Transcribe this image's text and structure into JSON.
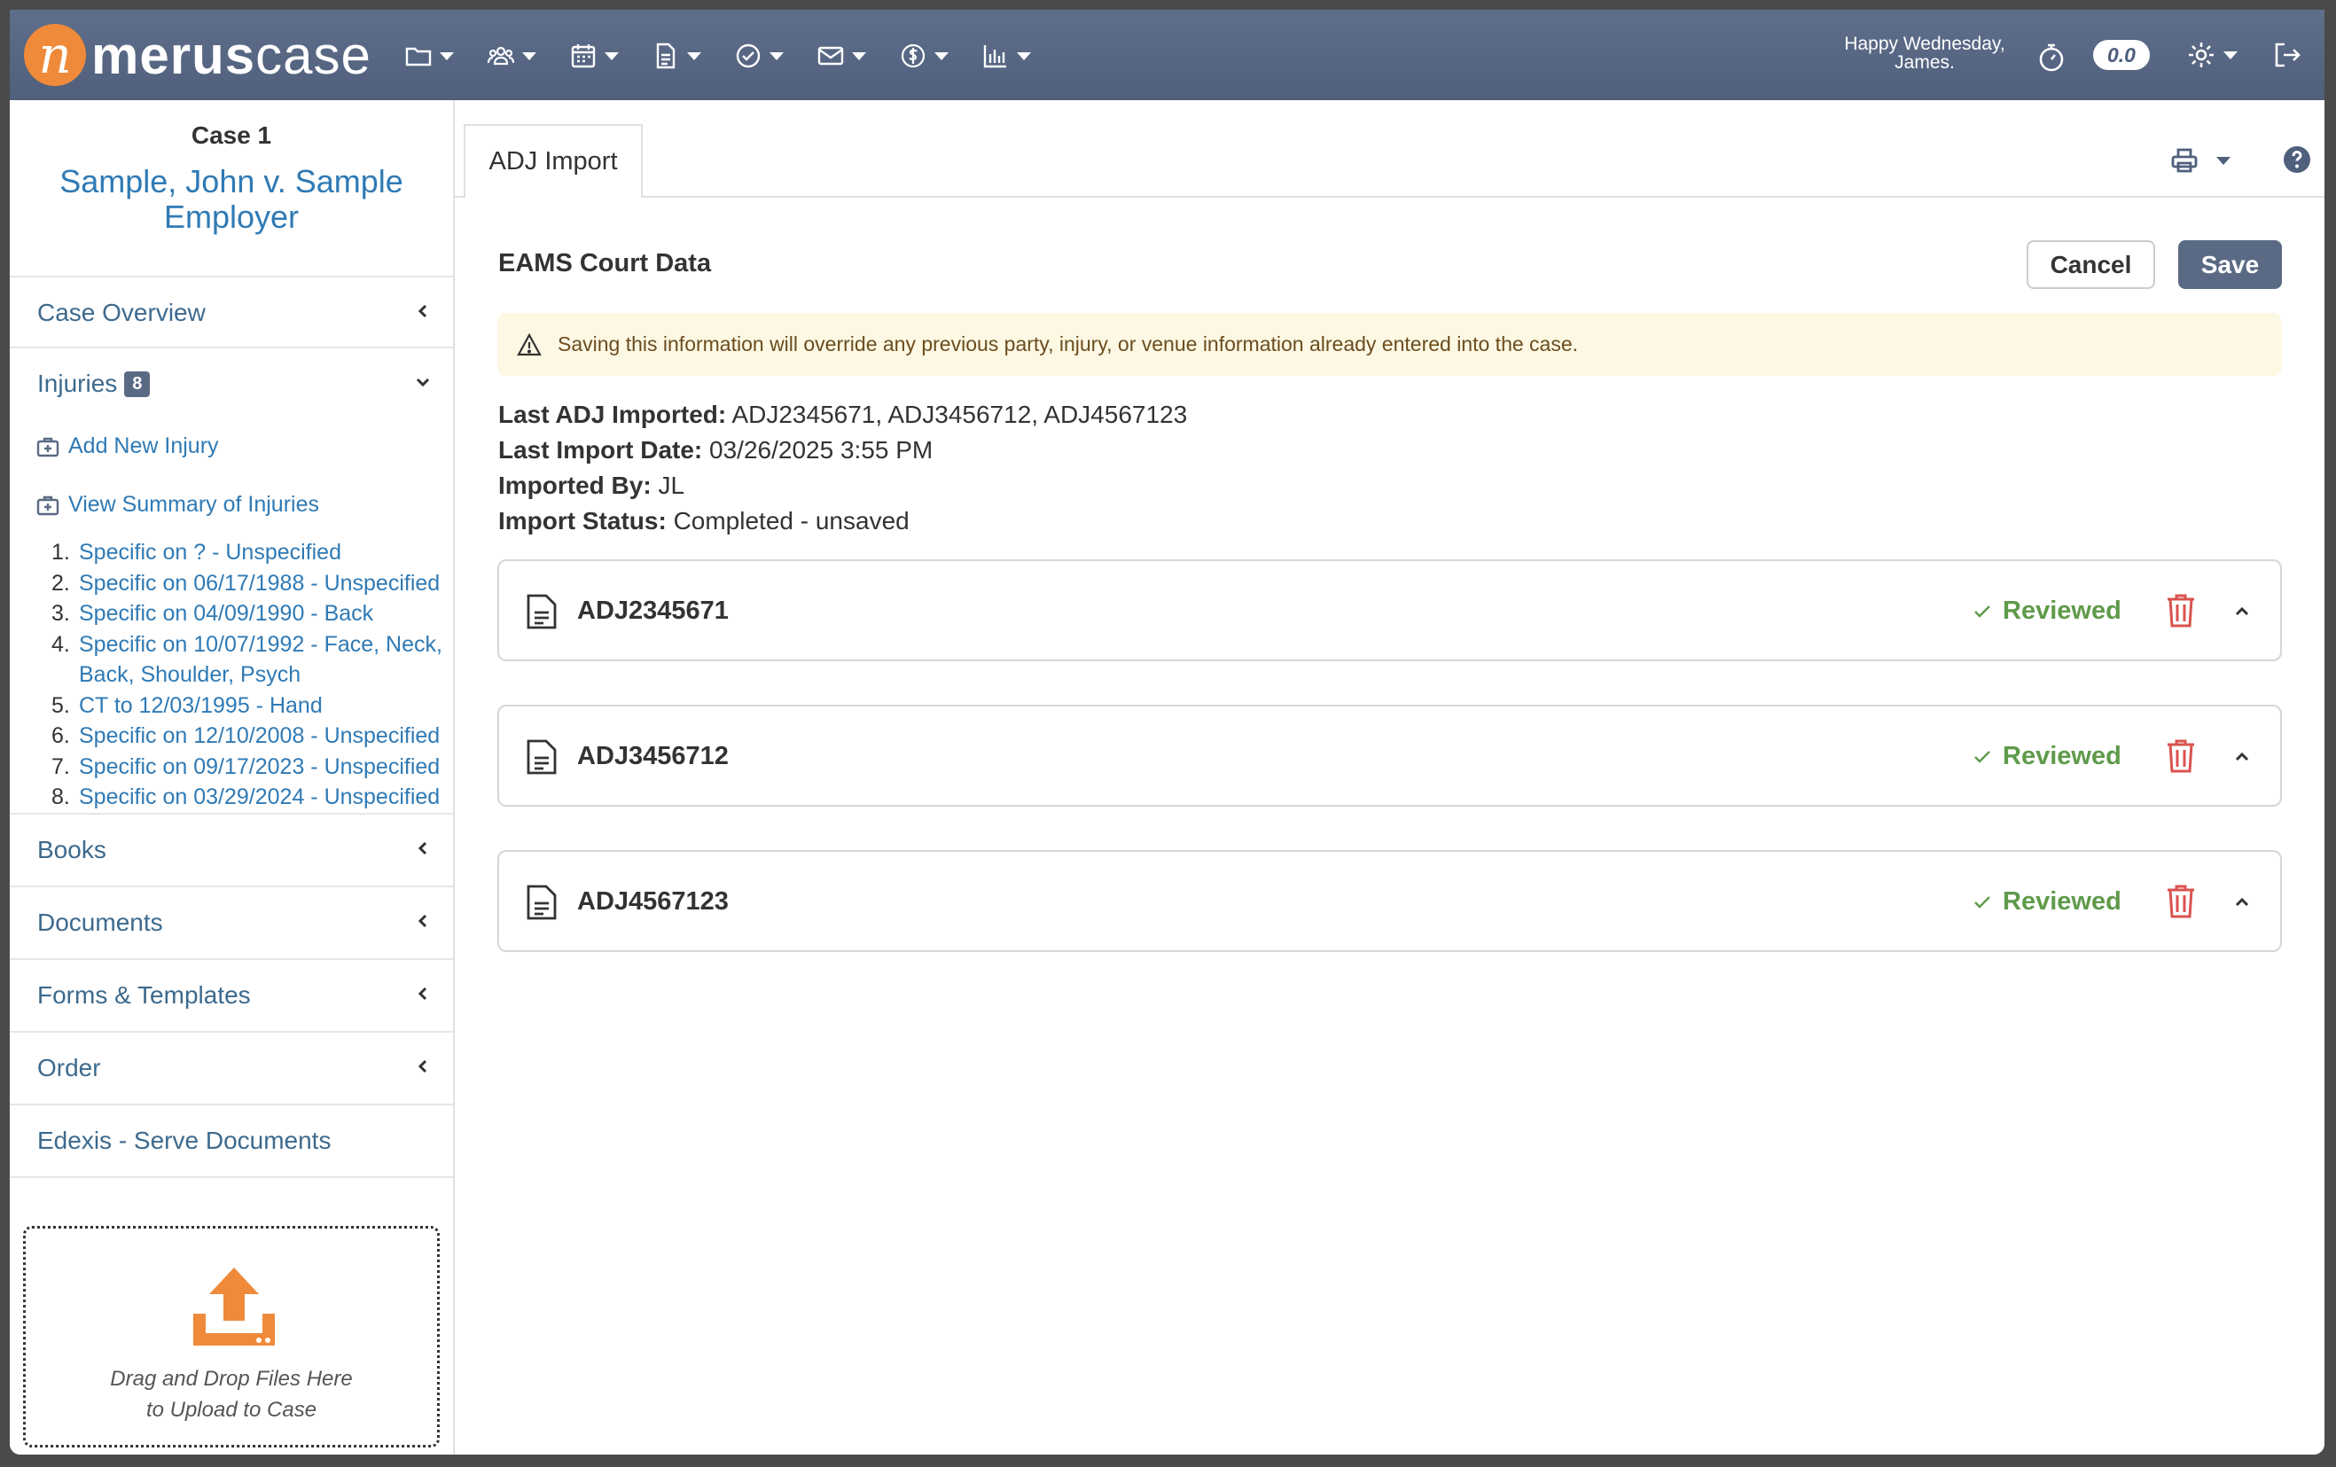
{
  "topbar": {
    "logo_mark": "n",
    "logo_bold": "merus",
    "logo_light": "case",
    "nav_icons": [
      "folder-icon",
      "contacts-icon",
      "calendar-icon",
      "document-icon",
      "task-check-icon",
      "mail-icon",
      "billing-icon",
      "reports-icon"
    ],
    "greeting_line1": "Happy Wednesday,",
    "greeting_line2": "James.",
    "timer_value": "0.0"
  },
  "sidebar": {
    "case_label": "Case 1",
    "case_title": "Sample, John v. Sample Employer",
    "case_overview": "Case Overview",
    "injuries_label": "Injuries",
    "injuries_count": "8",
    "add_new_injury": "Add New Injury",
    "view_summary": "View Summary of Injuries",
    "injuries": [
      {
        "num": "1.",
        "text": "Specific on ? - Unspecified"
      },
      {
        "num": "2.",
        "text": "Specific on 06/17/1988 - Unspecified"
      },
      {
        "num": "3.",
        "text": "Specific on 04/09/1990 - Back"
      },
      {
        "num": "4.",
        "text": "Specific on 10/07/1992 - Face, Neck, Back, Shoulder, Psych"
      },
      {
        "num": "5.",
        "text": "CT to 12/03/1995 - Hand"
      },
      {
        "num": "6.",
        "text": "Specific on 12/10/2008 - Unspecified"
      },
      {
        "num": "7.",
        "text": "Specific on 09/17/2023 - Unspecified"
      },
      {
        "num": "8.",
        "text": "Specific on 03/29/2024 - Unspecified"
      }
    ],
    "books": "Books",
    "documents": "Documents",
    "forms_templates": "Forms & Templates",
    "order": "Order",
    "edexis": "Edexis - Serve Documents",
    "drop_line1": "Drag and Drop Files Here",
    "drop_line2": "to Upload to Case"
  },
  "main": {
    "tab_label": "ADJ Import",
    "section_title": "EAMS Court Data",
    "cancel_label": "Cancel",
    "save_label": "Save",
    "warning_text": "Saving this information will override any previous party, injury, or venue information already entered into the case.",
    "info": {
      "last_adj_label": "Last ADJ Imported:",
      "last_adj_value": "ADJ2345671, ADJ3456712, ADJ4567123",
      "last_date_label": "Last Import Date:",
      "last_date_value": "03/26/2025 3:55 PM",
      "imported_by_label": "Imported By:",
      "imported_by_value": "JL",
      "status_label": "Import Status:",
      "status_value": "Completed - unsaved"
    },
    "cards": [
      {
        "adj": "ADJ2345671",
        "status": "Reviewed"
      },
      {
        "adj": "ADJ3456712",
        "status": "Reviewed"
      },
      {
        "adj": "ADJ4567123",
        "status": "Reviewed"
      }
    ]
  },
  "colors": {
    "topbar": "#5f6f8b",
    "brand_orange": "#ef8a3a",
    "link_blue": "#2f7ab5",
    "save_button": "#5b6a84",
    "reviewed_green": "#5f9a4a",
    "trash_red": "#d9534f",
    "warning_bg": "#fcf8e3"
  }
}
